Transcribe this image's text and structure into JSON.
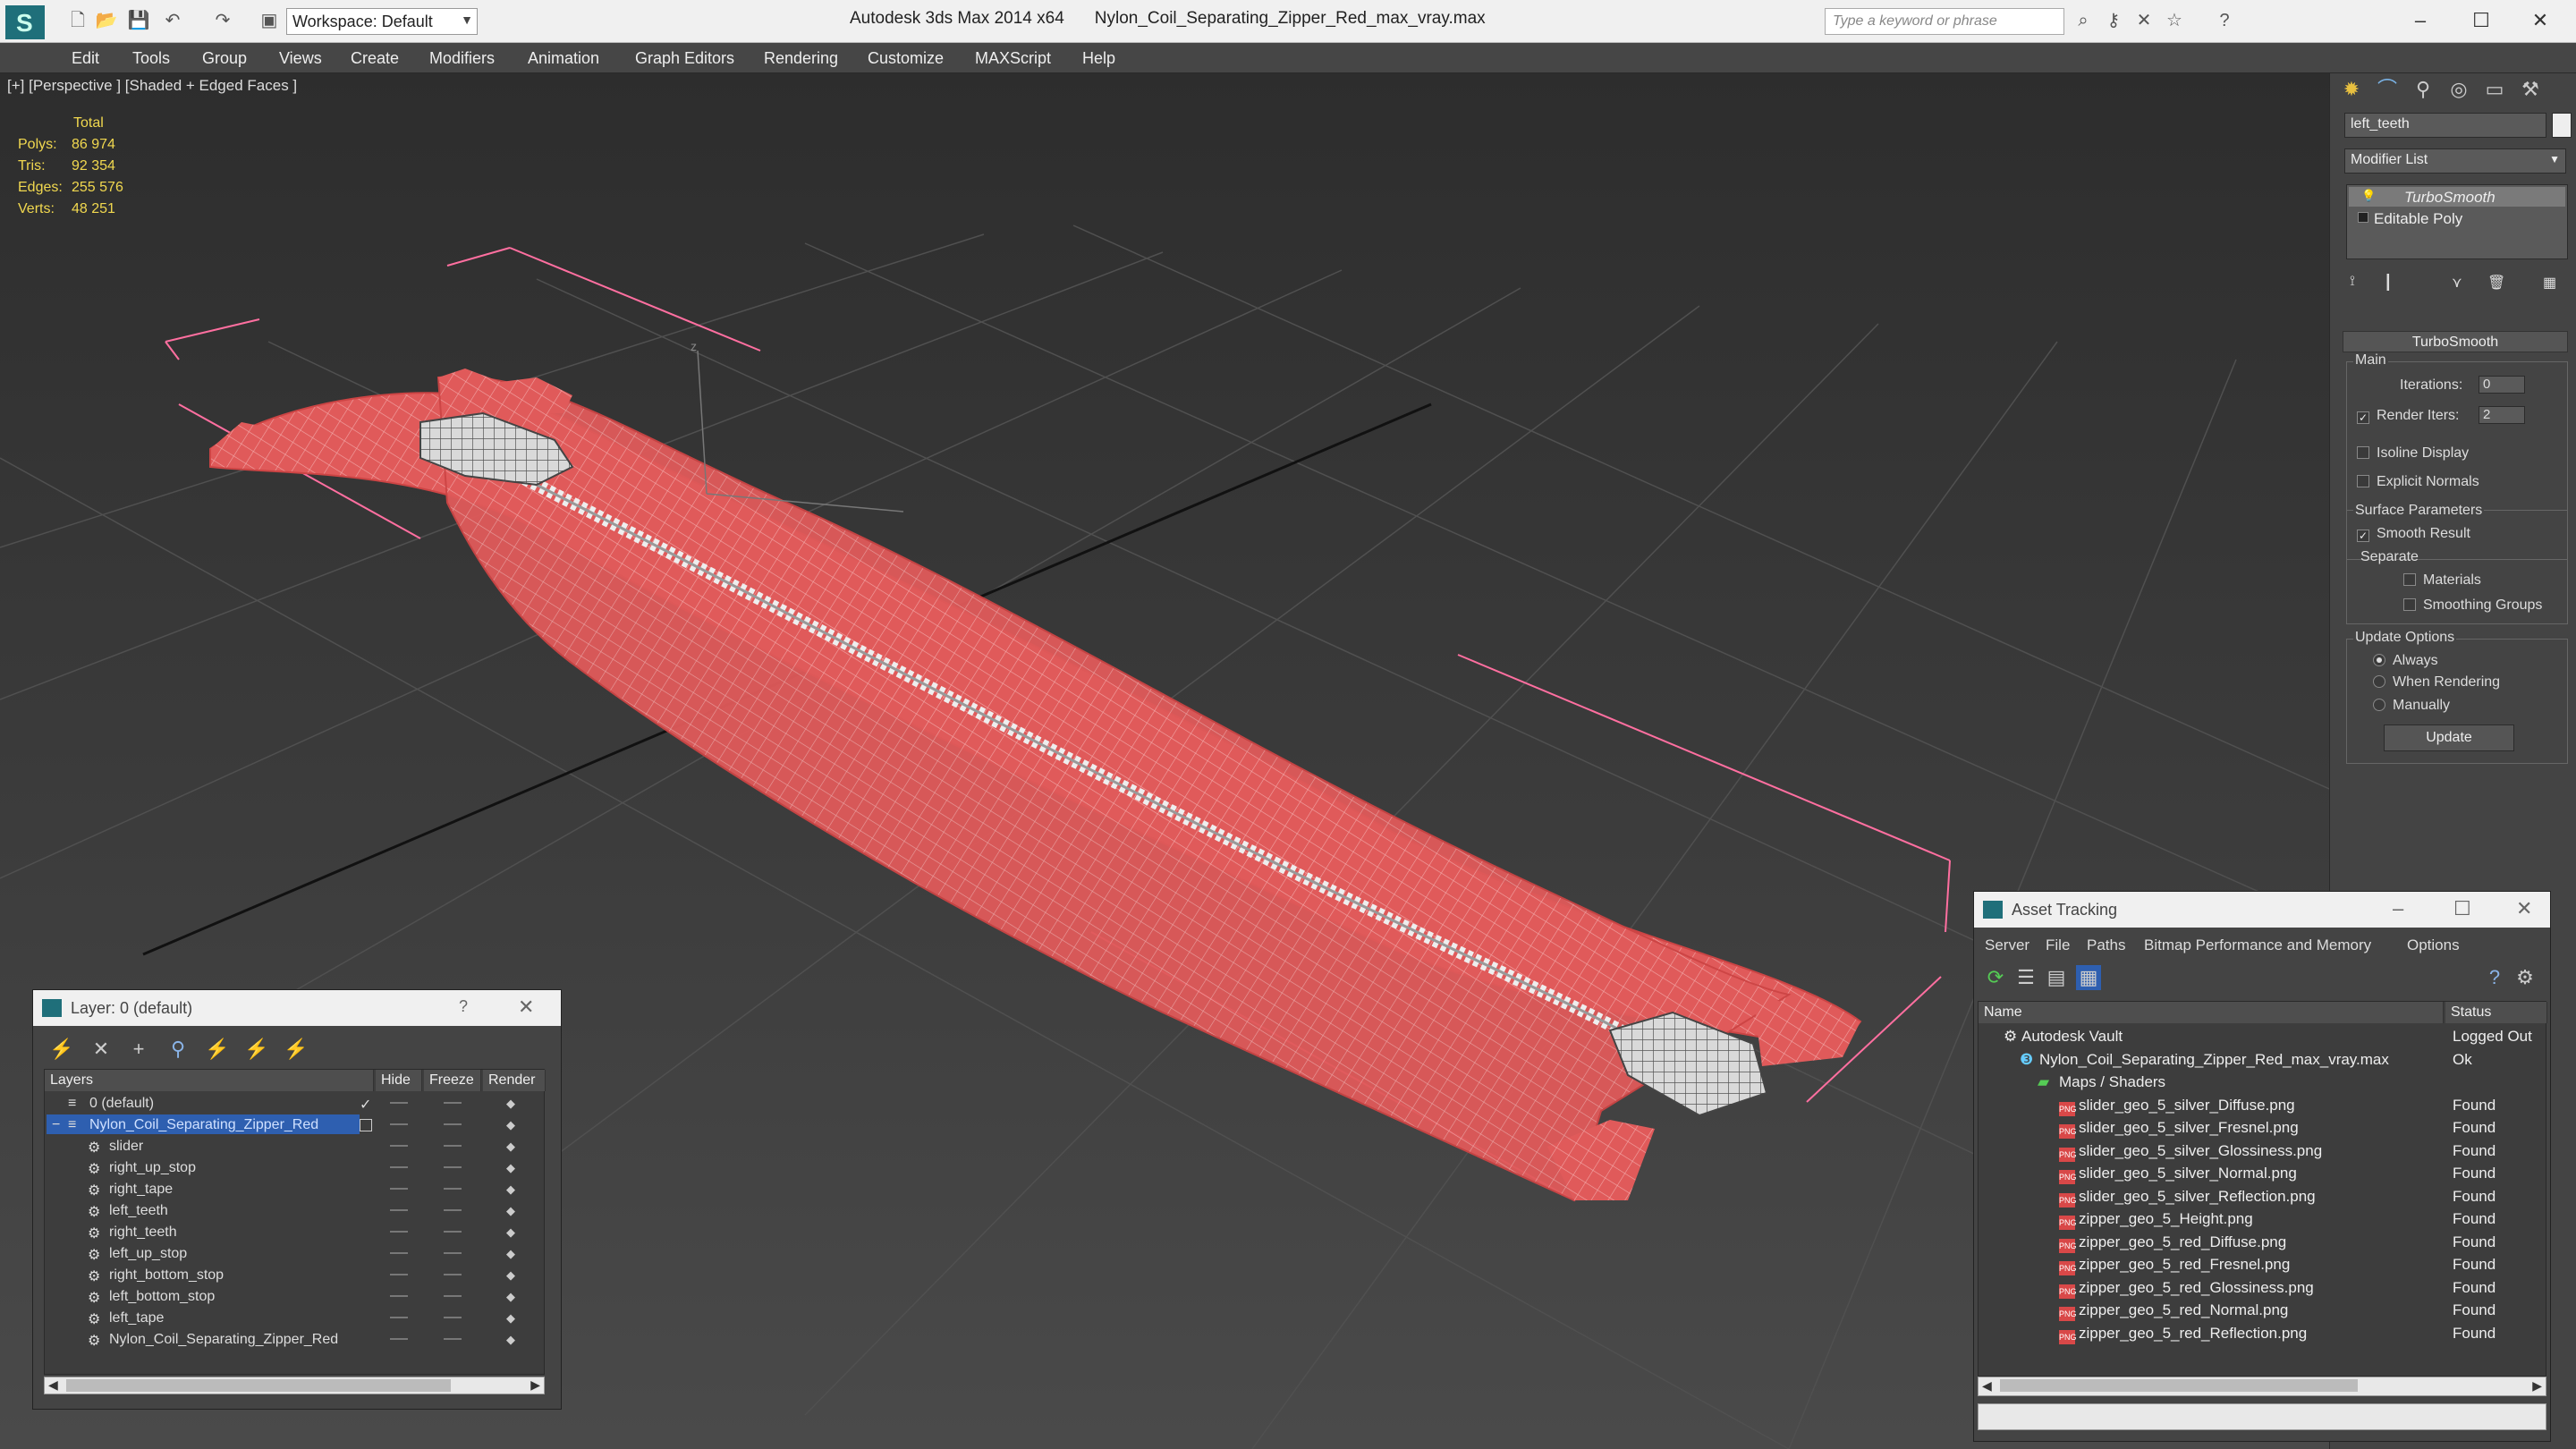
{
  "titlebar": {
    "app": "Autodesk 3ds Max  2014 x64",
    "file": "Nylon_Coil_Separating_Zipper_Red_max_vray.max",
    "workspace": "Workspace: Default",
    "search_placeholder": "Type a keyword or phrase"
  },
  "menu": [
    "Edit",
    "Tools",
    "Group",
    "Views",
    "Create",
    "Modifiers",
    "Animation",
    "Graph Editors",
    "Rendering",
    "Customize",
    "MAXScript",
    "Help"
  ],
  "viewport": {
    "label": "[+] [Perspective ] [Shaded + Edged Faces ]",
    "stats": {
      "header": "Total",
      "polys_label": "Polys:",
      "polys": "86 974",
      "tris_label": "Tris:",
      "tris": "92 354",
      "edges_label": "Edges:",
      "edges": "255 576",
      "verts_label": "Verts:",
      "verts": "48 251"
    },
    "colors": {
      "mesh": "#e05a5a",
      "wire": "#f0a0a0",
      "gizmo": "#ff6fa0"
    }
  },
  "command_panel": {
    "object_name": "left_teeth",
    "modifier_list": "Modifier List",
    "stack": [
      "TurboSmooth",
      "Editable Poly"
    ],
    "turbosmooth": {
      "title": "TurboSmooth",
      "main": "Main",
      "iterations_label": "Iterations:",
      "iterations": "0",
      "render_iters_label": "Render Iters:",
      "render_iters": "2",
      "isoline": "Isoline Display",
      "explicit_normals": "Explicit Normals",
      "surface_params": "Surface Parameters",
      "smooth_result": "Smooth Result",
      "separate": "Separate",
      "materials": "Materials",
      "smoothing_groups": "Smoothing Groups",
      "update_options": "Update Options",
      "always": "Always",
      "when_rendering": "When Rendering",
      "manually": "Manually",
      "update_btn": "Update"
    }
  },
  "layer_dialog": {
    "title": "Layer: 0 (default)",
    "columns": [
      "Layers",
      "Hide",
      "Freeze",
      "Render"
    ],
    "rows": [
      "0 (default)",
      "Nylon_Coil_Separating_Zipper_Red",
      "slider",
      "right_up_stop",
      "right_tape",
      "left_teeth",
      "right_teeth",
      "left_up_stop",
      "right_bottom_stop",
      "left_bottom_stop",
      "left_tape",
      "Nylon_Coil_Separating_Zipper_Red"
    ]
  },
  "asset_dialog": {
    "title": "Asset Tracking",
    "menu": [
      "Server",
      "File",
      "Paths",
      "Bitmap Performance and Memory",
      "Options"
    ],
    "columns": [
      "Name",
      "Status"
    ],
    "vault": "Autodesk Vault",
    "vault_status": "Logged Out",
    "scene": "Nylon_Coil_Separating_Zipper_Red_max_vray.max",
    "scene_status": "Ok",
    "maps": "Maps / Shaders",
    "files": [
      {
        "name": "slider_geo_5_silver_Diffuse.png",
        "status": "Found"
      },
      {
        "name": "slider_geo_5_silver_Fresnel.png",
        "status": "Found"
      },
      {
        "name": "slider_geo_5_silver_Glossiness.png",
        "status": "Found"
      },
      {
        "name": "slider_geo_5_silver_Normal.png",
        "status": "Found"
      },
      {
        "name": "slider_geo_5_silver_Reflection.png",
        "status": "Found"
      },
      {
        "name": "zipper_geo_5_Height.png",
        "status": "Found"
      },
      {
        "name": "zipper_geo_5_red_Diffuse.png",
        "status": "Found"
      },
      {
        "name": "zipper_geo_5_red_Fresnel.png",
        "status": "Found"
      },
      {
        "name": "zipper_geo_5_red_Glossiness.png",
        "status": "Found"
      },
      {
        "name": "zipper_geo_5_red_Normal.png",
        "status": "Found"
      },
      {
        "name": "zipper_geo_5_red_Reflection.png",
        "status": "Found"
      }
    ]
  }
}
